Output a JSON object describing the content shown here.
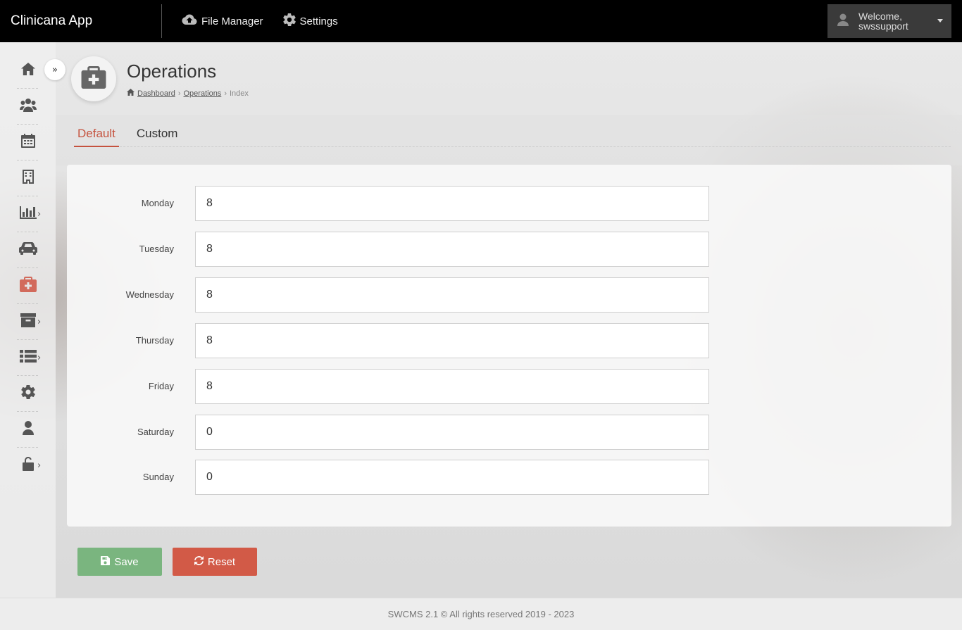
{
  "app": {
    "brand": "Clinicana App"
  },
  "topnav": [
    {
      "label": "File Manager",
      "icon": "cloud-upload-icon"
    },
    {
      "label": "Settings",
      "icon": "gear-icon"
    }
  ],
  "user": {
    "welcome": "Welcome,",
    "name": "swssupport"
  },
  "sidebar": {
    "items": [
      {
        "icon": "home-icon"
      },
      {
        "icon": "users-icon"
      },
      {
        "icon": "calendar-icon"
      },
      {
        "icon": "building-icon"
      },
      {
        "icon": "chart-bar-icon",
        "has_submenu": true
      },
      {
        "icon": "car-icon"
      },
      {
        "icon": "medkit-icon",
        "active": true
      },
      {
        "icon": "archive-icon",
        "has_submenu": true
      },
      {
        "icon": "list-icon",
        "has_submenu": true
      },
      {
        "icon": "gear-icon"
      },
      {
        "icon": "user-icon"
      },
      {
        "icon": "unlock-icon",
        "has_submenu": true
      }
    ],
    "accent": "#d26a5c"
  },
  "page": {
    "title": "Operations",
    "breadcrumb": {
      "home": "Dashboard",
      "section": "Operations",
      "current": "Index"
    }
  },
  "tabs": [
    {
      "label": "Default",
      "active": true
    },
    {
      "label": "Custom",
      "active": false
    }
  ],
  "form": {
    "days": [
      {
        "label": "Monday",
        "value": "8"
      },
      {
        "label": "Tuesday",
        "value": "8"
      },
      {
        "label": "Wednesday",
        "value": "8"
      },
      {
        "label": "Thursday",
        "value": "8"
      },
      {
        "label": "Friday",
        "value": "8"
      },
      {
        "label": "Saturday",
        "value": "0"
      },
      {
        "label": "Sunday",
        "value": "0"
      }
    ]
  },
  "actions": {
    "save_label": "Save",
    "reset_label": "Reset",
    "save_color": "#7ab57f",
    "reset_color": "#d25a47"
  },
  "footer": {
    "text": "SWCMS 2.1 © All rights reserved 2019 - 2023"
  }
}
